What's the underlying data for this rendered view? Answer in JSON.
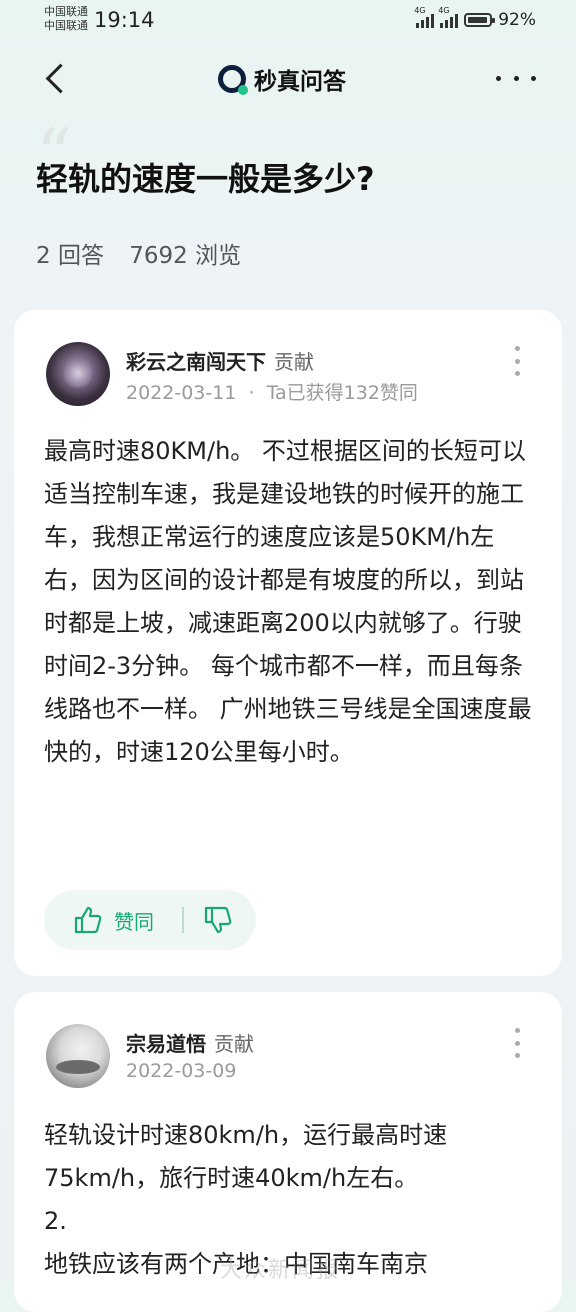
{
  "status": {
    "carrier_line1": "中国联通",
    "carrier_line2": "中国联通",
    "time": "19:14",
    "battery": "92%"
  },
  "nav": {
    "brand": "秒真问答"
  },
  "question": {
    "title": "轻轨的速度一般是多少?",
    "answers_count": "2 回答",
    "views": "7692 浏览"
  },
  "answers": [
    {
      "author": "彩云之南闯天下",
      "tag": "贡献",
      "date": "2022-03-11",
      "meta_sep": "·",
      "likes_info": "Ta已获得132赞同",
      "body": "最高时速80KM/h。 不过根据区间的长短可以适当控制车速，我是建设地铁的时候开的施工车，我想正常运行的速度应该是50KM/h左右，因为区间的设计都是有坡度的所以，到站时都是上坡，减速距离200以内就够了。行驶时间2-3分钟。 每个城市都不一样，而且每条线路也不一样。 广州地铁三号线是全国速度最快的，时速120公里每小时。",
      "like_label": "赞同"
    },
    {
      "author": "宗易道悟",
      "tag": "贡献",
      "date": "2022-03-09",
      "body": "轻轨设计时速80km/h，运行最高时速75km/h，旅行时速40km/h左右。\n2.\n地铁应该有两个产地：中国南车南京"
    }
  ],
  "watermark": "大众新闻报"
}
